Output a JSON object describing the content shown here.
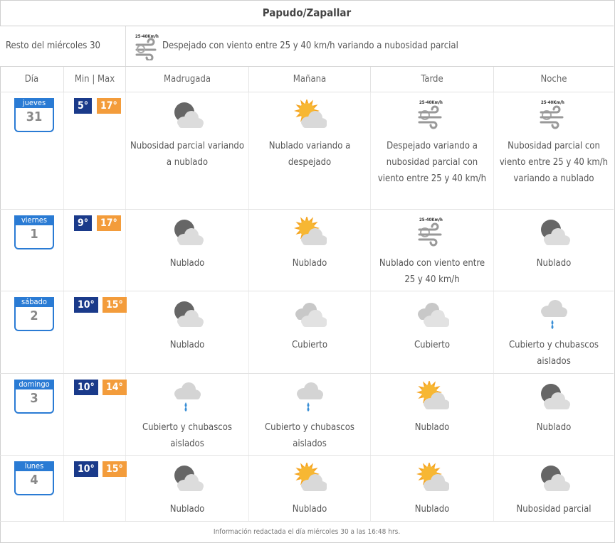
{
  "title": "Papudo/Zapallar",
  "rest": {
    "label": "Resto del miércoles 30",
    "wind_badge": "25-40Km/h",
    "text": "Despejado con viento entre 25 y 40 km/h variando a nubosidad parcial"
  },
  "headers": {
    "day": "Día",
    "minmax": "Min | Max",
    "madrugada": "Madrugada",
    "manana": "Mañana",
    "tarde": "Tarde",
    "noche": "Noche"
  },
  "days": [
    {
      "weekday": "jueves",
      "num": "31",
      "min": "5°",
      "max": "17°",
      "periods": [
        {
          "icon": "night-partly-cloudy-icon",
          "text": "Nubosidad parcial variando a nublado"
        },
        {
          "icon": "sun-cloud-icon",
          "text": "Nublado variando a despejado"
        },
        {
          "icon": "wind-icon",
          "badge": "25-40Km/h",
          "text": "Despejado variando a nubosidad parcial con viento entre 25 y 40 km/h"
        },
        {
          "icon": "wind-icon",
          "badge": "25-40Km/h",
          "text": "Nubosidad parcial con viento entre 25 y 40 km/h variando a nublado"
        }
      ]
    },
    {
      "weekday": "viernes",
      "num": "1",
      "min": "9°",
      "max": "17°",
      "periods": [
        {
          "icon": "night-cloudy-icon",
          "text": "Nublado"
        },
        {
          "icon": "sun-cloud-icon",
          "text": "Nublado"
        },
        {
          "icon": "wind-icon",
          "badge": "25-40Km/h",
          "text": "Nublado con viento entre 25 y 40 km/h"
        },
        {
          "icon": "night-cloudy-icon",
          "text": "Nublado"
        }
      ]
    },
    {
      "weekday": "sábado",
      "num": "2",
      "min": "10°",
      "max": "15°",
      "periods": [
        {
          "icon": "night-cloudy-icon",
          "text": "Nublado"
        },
        {
          "icon": "overcast-icon",
          "text": "Cubierto"
        },
        {
          "icon": "overcast-icon",
          "text": "Cubierto"
        },
        {
          "icon": "rain-cloud-icon",
          "text": "Cubierto y chubascos aislados"
        }
      ]
    },
    {
      "weekday": "domingo",
      "num": "3",
      "min": "10°",
      "max": "14°",
      "periods": [
        {
          "icon": "rain-cloud-icon",
          "text": "Cubierto y chubascos aislados"
        },
        {
          "icon": "rain-cloud-icon",
          "text": "Cubierto y chubascos aislados"
        },
        {
          "icon": "sun-cloud-icon",
          "text": "Nublado"
        },
        {
          "icon": "night-cloudy-icon",
          "text": "Nublado"
        }
      ]
    },
    {
      "weekday": "lunes",
      "num": "4",
      "min": "10°",
      "max": "15°",
      "periods": [
        {
          "icon": "night-cloudy-icon",
          "text": "Nublado"
        },
        {
          "icon": "sun-cloud-icon",
          "text": "Nublado"
        },
        {
          "icon": "sun-cloud-icon",
          "text": "Nublado"
        },
        {
          "icon": "night-partly-cloudy-icon",
          "text": "Nubosidad parcial"
        }
      ]
    }
  ],
  "footer": "Información redactada el día miércoles 30 a las 16:48 hrs.",
  "colors": {
    "min_bg": "#1a3a8a",
    "max_bg": "#f39c3b",
    "calendar": "#2a7bd4"
  }
}
